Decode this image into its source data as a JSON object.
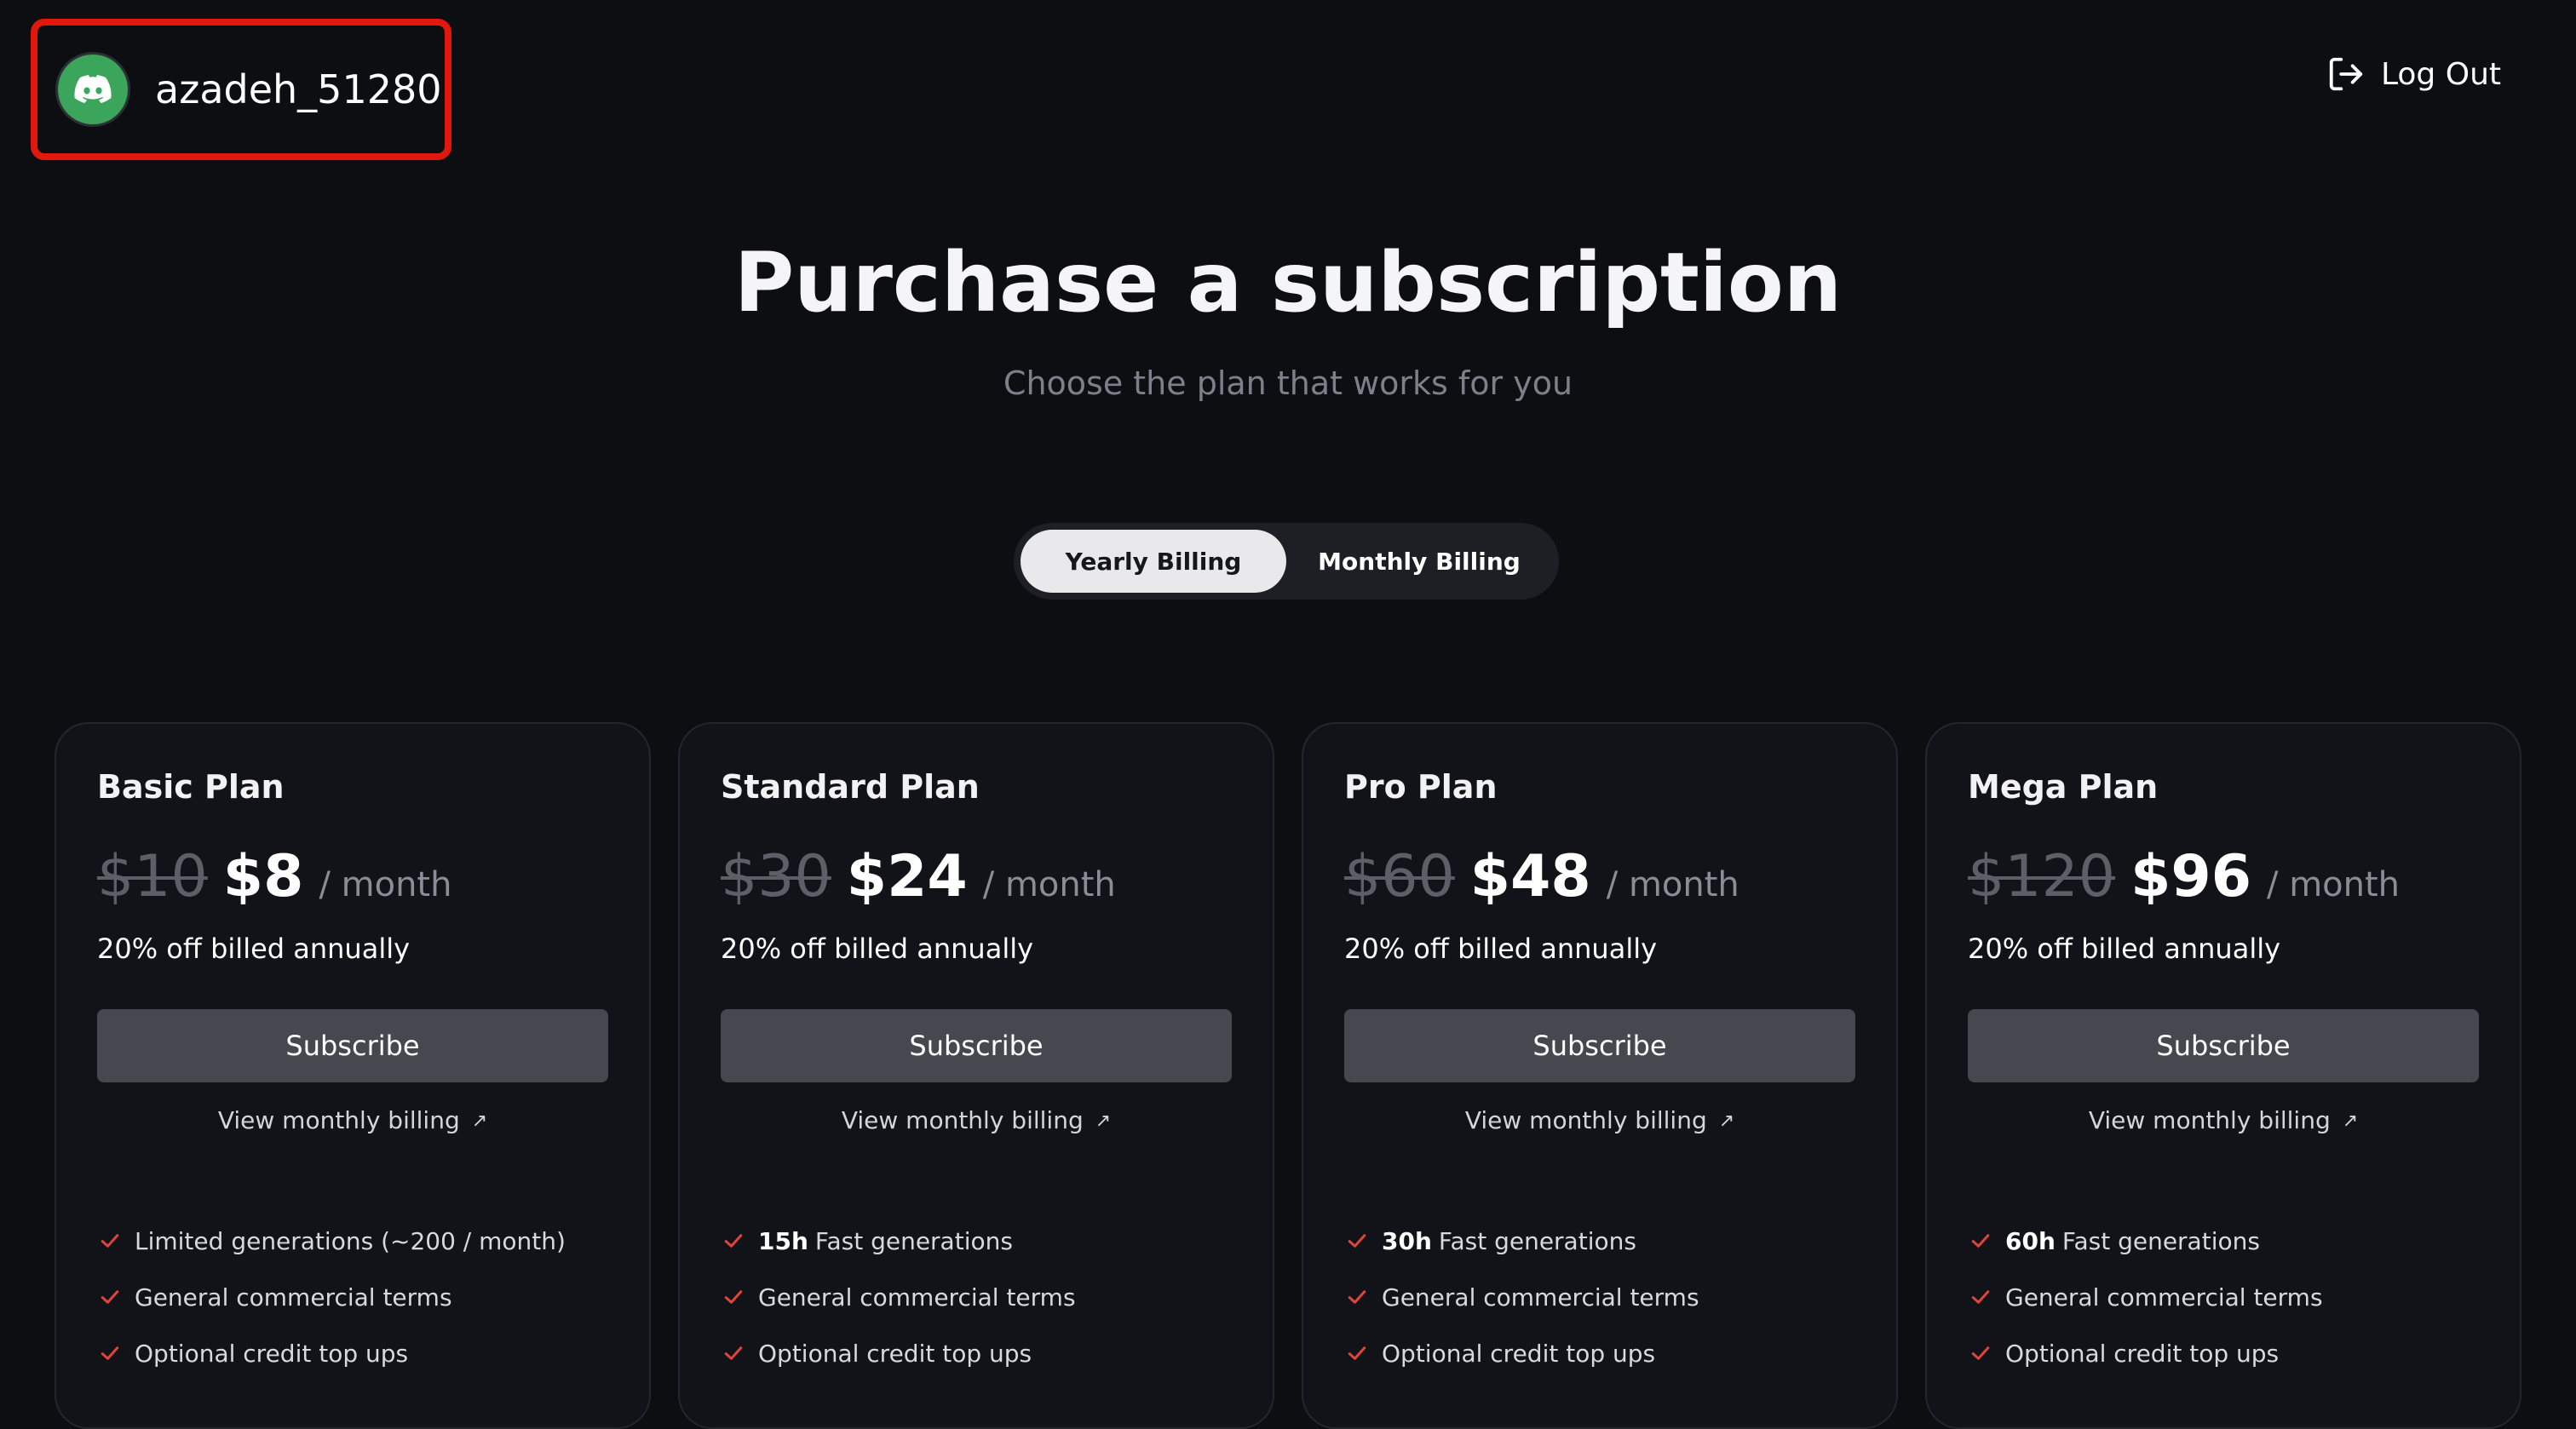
{
  "header": {
    "username": "azadeh_51280",
    "avatar_icon": "discord-icon",
    "avatar_color": "#3ba55c",
    "highlight_color": "#e3180d",
    "logout_label": "Log Out",
    "logout_icon": "log-out-icon"
  },
  "hero": {
    "title": "Purchase a subscription",
    "subtitle": "Choose the plan that works for you"
  },
  "billing_toggle": {
    "options": [
      "Yearly Billing",
      "Monthly Billing"
    ],
    "selected": "Yearly Billing"
  },
  "plans": [
    {
      "name": "Basic Plan",
      "old_price": "$10",
      "price": "$8",
      "per": "/ month",
      "discount": "20% off billed annually",
      "cta": "Subscribe",
      "monthly_link": "View monthly billing",
      "features": [
        {
          "strong": "",
          "text": "Limited generations (~200 / month)"
        },
        {
          "strong": "",
          "text": "General commercial terms"
        },
        {
          "strong": "",
          "text": "Optional credit top ups"
        }
      ]
    },
    {
      "name": "Standard Plan",
      "old_price": "$30",
      "price": "$24",
      "per": "/ month",
      "discount": "20% off billed annually",
      "cta": "Subscribe",
      "monthly_link": "View monthly billing",
      "features": [
        {
          "strong": "15h",
          "text": "Fast generations"
        },
        {
          "strong": "",
          "text": "General commercial terms"
        },
        {
          "strong": "",
          "text": "Optional credit top ups"
        }
      ]
    },
    {
      "name": "Pro Plan",
      "old_price": "$60",
      "price": "$48",
      "per": "/ month",
      "discount": "20% off billed annually",
      "cta": "Subscribe",
      "monthly_link": "View monthly billing",
      "features": [
        {
          "strong": "30h",
          "text": "Fast generations"
        },
        {
          "strong": "",
          "text": "General commercial terms"
        },
        {
          "strong": "",
          "text": "Optional credit top ups"
        }
      ]
    },
    {
      "name": "Mega Plan",
      "old_price": "$120",
      "price": "$96",
      "per": "/ month",
      "discount": "20% off billed annually",
      "cta": "Subscribe",
      "monthly_link": "View monthly billing",
      "features": [
        {
          "strong": "60h",
          "text": "Fast generations"
        },
        {
          "strong": "",
          "text": "General commercial terms"
        },
        {
          "strong": "",
          "text": "Optional credit top ups"
        }
      ]
    }
  ],
  "colors": {
    "background": "#0d0e12",
    "card": "#121318",
    "button": "#464850",
    "check": "#e0443a"
  }
}
